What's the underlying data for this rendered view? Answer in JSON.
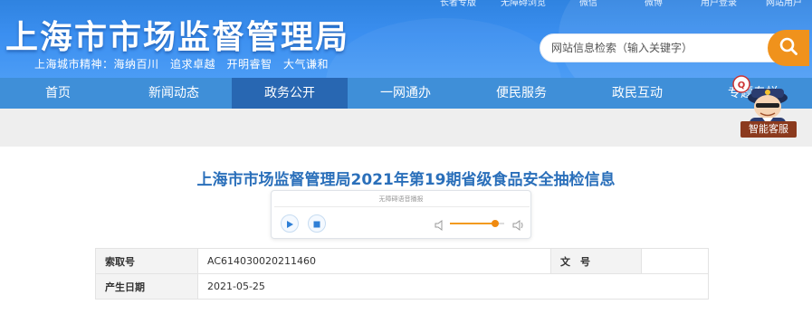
{
  "header": {
    "top_links": [
      "长者专版",
      "无障碍浏览",
      "微信",
      "微博",
      "用户登录",
      "网站用户"
    ],
    "site_title": "上海市市场监督管理局",
    "motto": "上海城市精神：海纳百川　追求卓越　开明睿智　大气谦和",
    "search": {
      "placeholder": "网站信息检索（输入关键字）"
    }
  },
  "nav": {
    "items": [
      {
        "label": "首页"
      },
      {
        "label": "新闻动态"
      },
      {
        "label": "政务公开"
      },
      {
        "label": "一网通办"
      },
      {
        "label": "便民服务"
      },
      {
        "label": "政民互动"
      },
      {
        "label": "专题专栏"
      }
    ],
    "active_index": 2
  },
  "assistant": {
    "label": "智能客服"
  },
  "article": {
    "title": "上海市市场监督管理局2021年第19期省级食品安全抽检信息"
  },
  "player": {
    "title": "无障碍语音播报",
    "volume_level": 0.75
  },
  "info": {
    "rows": [
      {
        "label1": "索取号",
        "value1": "AC614030020211460",
        "label2": "文　号",
        "value2": ""
      },
      {
        "label1": "产生日期",
        "value1": "2021-05-25"
      }
    ]
  },
  "colors": {
    "header_blue": "#3b8ff0",
    "nav_blue": "#3f8fd8",
    "nav_active": "#2867b2",
    "search_button": "#f0921c",
    "title_blue": "#2a6fba"
  }
}
